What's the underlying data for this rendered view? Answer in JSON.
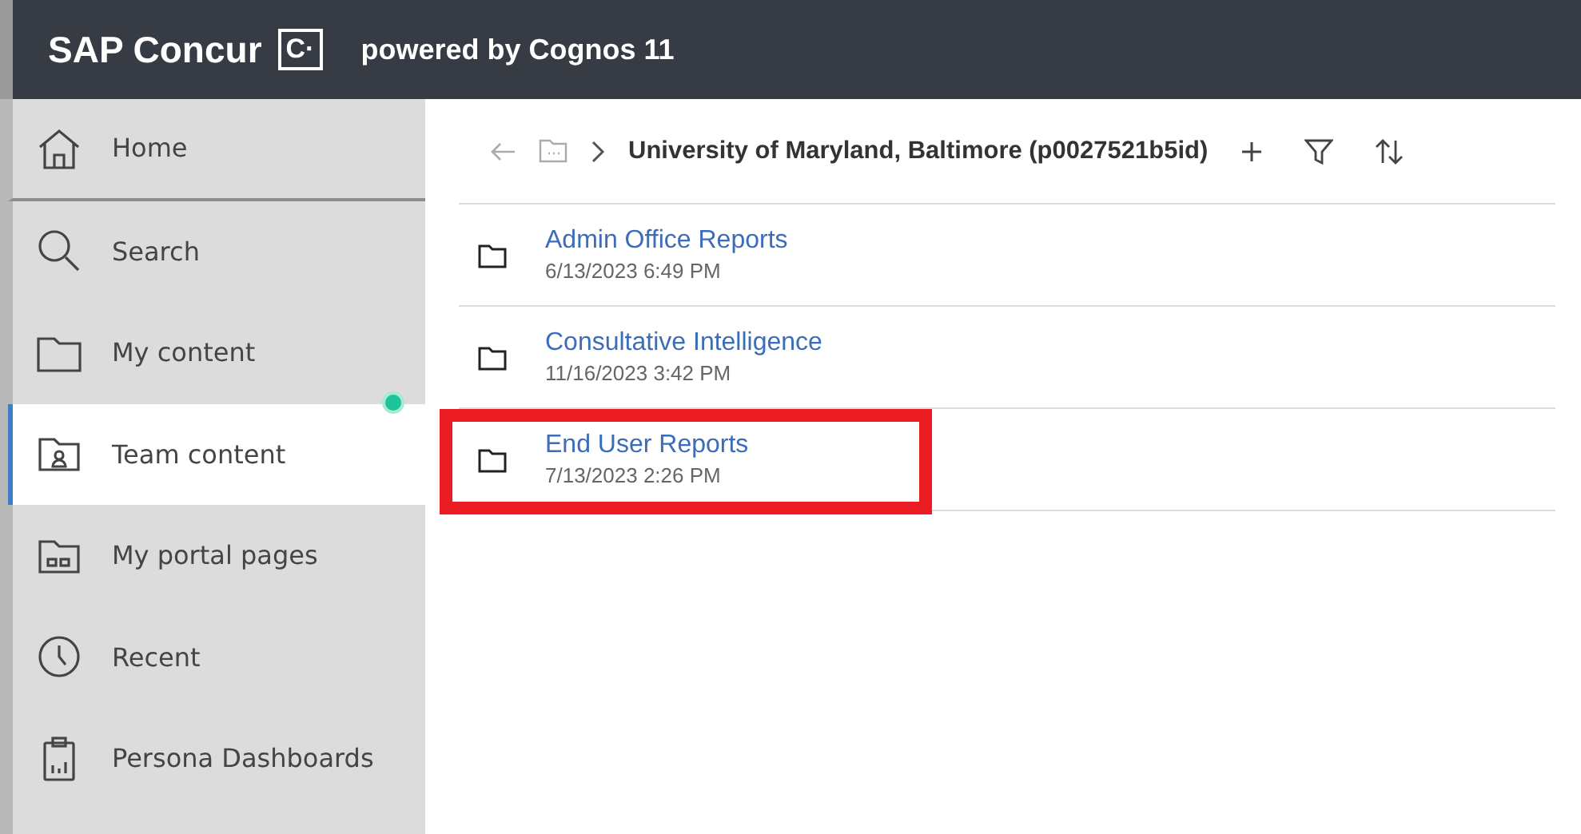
{
  "header": {
    "brand": "SAP Concur",
    "brand_mark": "C·",
    "subtitle": "powered by Cognos 11"
  },
  "sidebar": {
    "items": [
      {
        "kind": "home",
        "label": "Home",
        "selected": false,
        "notification": false
      },
      {
        "kind": "search",
        "label": "Search",
        "selected": false,
        "notification": false
      },
      {
        "kind": "folder",
        "label": "My content",
        "selected": false,
        "notification": false
      },
      {
        "kind": "team",
        "label": "Team content",
        "selected": true,
        "notification": true
      },
      {
        "kind": "portal",
        "label": "My portal pages",
        "selected": false,
        "notification": false
      },
      {
        "kind": "recent",
        "label": "Recent",
        "selected": false,
        "notification": false
      },
      {
        "kind": "clipboard",
        "label": "Persona Dashboards",
        "selected": false,
        "notification": false
      }
    ]
  },
  "breadcrumb": {
    "title": "University of Maryland, Baltimore (p0027521b5id)"
  },
  "rows": [
    {
      "name": "Admin Office Reports",
      "date": "6/13/2023 6:49 PM",
      "highlighted": false
    },
    {
      "name": "Consultative Intelligence",
      "date": "11/16/2023 3:42 PM",
      "highlighted": false
    },
    {
      "name": "End User Reports",
      "date": "7/13/2023 2:26 PM",
      "highlighted": true
    }
  ]
}
